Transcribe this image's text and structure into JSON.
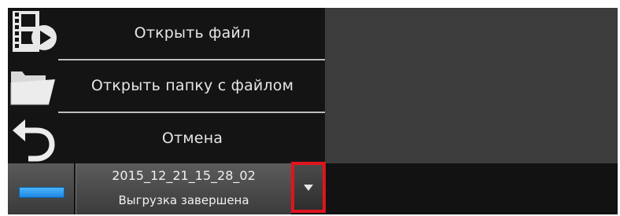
{
  "menu": {
    "items": [
      {
        "label": "Открыть файл",
        "icon": "film-play-icon"
      },
      {
        "label": "Открыть папку с файлом",
        "icon": "folder-open-icon"
      },
      {
        "label": "Отмена",
        "icon": "undo-arrow-icon"
      }
    ]
  },
  "download": {
    "filename": "2015_12_21_15_28_02",
    "status": "Выгрузка завершена",
    "progress_percent": 100
  },
  "dropdown": {
    "icon": "chevron-down-icon"
  },
  "colors": {
    "menu_bg": "#141414",
    "panel_bg": "#3c3c3c",
    "text": "#e6e6e6",
    "progress": "#2b9cf2",
    "highlight": "#e0141e"
  }
}
